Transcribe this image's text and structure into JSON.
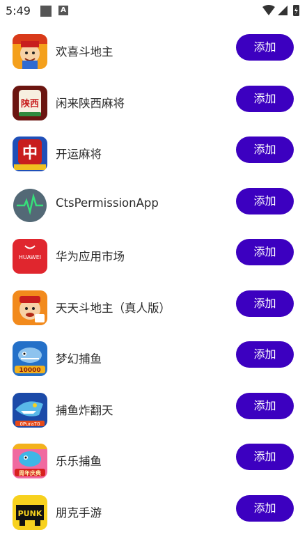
{
  "status_bar": {
    "time": "5:49",
    "notif_icon_letter": "A"
  },
  "apps": [
    {
      "name": "欢喜斗地主",
      "button": "添加",
      "icon": "poker-king-icon"
    },
    {
      "name": "闲来陕西麻将",
      "button": "添加",
      "icon": "shaanxi-mahjong-icon"
    },
    {
      "name": "开运麻将",
      "button": "添加",
      "icon": "mahjong-zhong-icon"
    },
    {
      "name": "CtsPermissionApp",
      "button": "添加",
      "icon": "heartbeat-icon"
    },
    {
      "name": "华为应用市场",
      "button": "添加",
      "icon": "huawei-appgallery-icon"
    },
    {
      "name": "天天斗地主（真人版）",
      "button": "添加",
      "icon": "poker-character-icon"
    },
    {
      "name": "梦幻捕鱼",
      "button": "添加",
      "icon": "fishing-game-icon"
    },
    {
      "name": "捕鱼炸翻天",
      "button": "添加",
      "icon": "shark-game-icon"
    },
    {
      "name": "乐乐捕鱼",
      "button": "添加",
      "icon": "fish-celebration-icon"
    },
    {
      "name": "朋克手游",
      "button": "添加",
      "icon": "punk-game-icon"
    }
  ],
  "icon_text": {
    "shaanxi": "陕西",
    "zhong": "中",
    "huawei": "HUAWEI",
    "fish_coins": "10000",
    "shark_label": "0Pura70",
    "celebration": "周年庆典",
    "punk": "PUNK"
  },
  "colors": {
    "accent": "#3c00c0",
    "text": "#2b2b2b"
  }
}
